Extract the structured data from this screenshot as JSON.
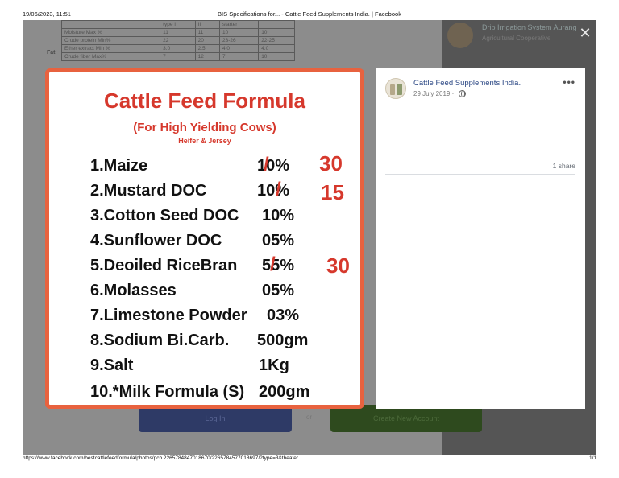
{
  "print": {
    "date": "19/06/2023, 11:51",
    "title": "BIS Specifications for... - Cattle Feed Supplements India. | Facebook",
    "url": "https://www.facebook.com/bestcattlefeedformula/photos/pcb.2265784847018670/2265784577018697/?type=3&theater",
    "page": "1/1"
  },
  "background": {
    "table_headers": [
      "",
      "type I",
      "II",
      "starter",
      ""
    ],
    "table_rows": [
      [
        "Moisture Max %",
        "11",
        "11",
        "10",
        "10"
      ],
      [
        "Crude protein Min%",
        "22",
        "20",
        "23-26",
        "22-25"
      ],
      [
        "Ether extract Min %",
        "3.0",
        "2.5",
        "4.0",
        "4.0"
      ],
      [
        "Crude fiber Max%",
        "7",
        "12",
        "7",
        "10"
      ]
    ],
    "fat_label": "Fat",
    "right_text1": "Drip Irrigation System Aurang",
    "right_text2": "Agricultural Cooperative",
    "login_label": "Log In",
    "or_label": "or",
    "create_label": "Create New Account"
  },
  "photo": {
    "title": "Cattle Feed Formula",
    "subtitle": "(For High Yielding Cows)",
    "subtitle2": "Heifer & Jersey",
    "ingredients": [
      {
        "name": "1.Maize",
        "amount": "10%",
        "note": "30"
      },
      {
        "name": "2.Mustard DOC",
        "amount": "10%",
        "note": "15"
      },
      {
        "name": "3.Cotton Seed DOC",
        "amount": "10%",
        "note": ""
      },
      {
        "name": "4.Sunflower DOC",
        "amount": "05%",
        "note": ""
      },
      {
        "name": "5.Deoiled RiceBran",
        "amount": "55%",
        "note": "30"
      },
      {
        "name": "6.Molasses",
        "amount": "05%",
        "note": ""
      },
      {
        "name": "7.Limestone Powder",
        "amount": "03%",
        "note": ""
      },
      {
        "name": "8.Sodium Bi.Carb.",
        "amount": "500gm",
        "note": ""
      },
      {
        "name": "9.Salt",
        "amount": "1Kg",
        "note": ""
      },
      {
        "name": "10.*Milk Formula (S)",
        "amount": "200gm",
        "note": ""
      }
    ]
  },
  "post": {
    "page_name": "Cattle Feed Supplements India.",
    "date": "29 July 2019 ·",
    "shares": "1 share"
  },
  "colors": {
    "accent_red": "#d6382c",
    "frame_orange": "#e8623f",
    "fb_link": "#2e4a86"
  },
  "icons": {
    "close": "close-icon",
    "more": "more-options-icon",
    "globe": "globe-icon"
  }
}
